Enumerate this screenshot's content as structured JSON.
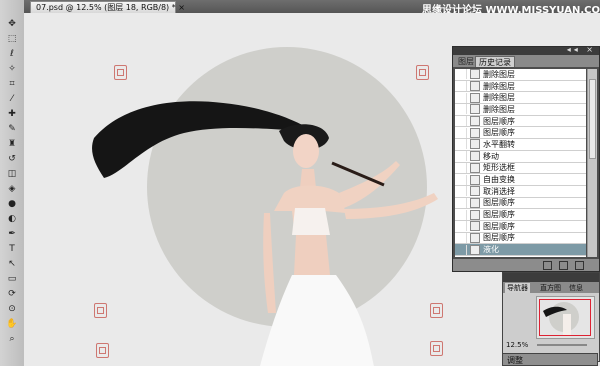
{
  "document_tab": {
    "title": "07.psd @ 12.5% (图层 18, RGB/8) *",
    "close": "×"
  },
  "watermark": "思缘设计论坛 WWW.MISSYUAN.COM",
  "toolbox": {
    "icons": [
      "move-tool-icon",
      "marquee-tool-icon",
      "lasso-tool-icon",
      "magic-wand-tool-icon",
      "crop-tool-icon",
      "eyedropper-tool-icon",
      "healing-brush-tool-icon",
      "brush-tool-icon",
      "clone-stamp-tool-icon",
      "history-brush-tool-icon",
      "eraser-tool-icon",
      "paint-bucket-tool-icon",
      "blur-tool-icon",
      "dodge-tool-icon",
      "pen-tool-icon",
      "type-tool-icon",
      "path-selection-tool-icon",
      "shape-tool-icon",
      "3d-rotate-tool-icon",
      "3d-orbit-tool-icon",
      "hand-tool-icon",
      "zoom-tool-icon"
    ],
    "glyphs": [
      "✥",
      "⬚",
      "ℓ",
      "✧",
      "⌗",
      "⁄",
      "✚",
      "✎",
      "♜",
      "↺",
      "◫",
      "◈",
      "●",
      "◐",
      "✒",
      "T",
      "↖",
      "▭",
      "⟳",
      "⊙",
      "✋",
      "⌕"
    ]
  },
  "panel": {
    "controls": "◂◂ ×",
    "tabs": [
      "图层",
      "历史记录"
    ],
    "active_tab": 1,
    "history": [
      "删除图层",
      "删除图层",
      "删除图层",
      "删除图层",
      "图层顺序",
      "图层顺序",
      "水平翻转",
      "移动",
      "矩形选框",
      "自由变换",
      "取消选择",
      "图层顺序",
      "图层顺序",
      "图层顺序",
      "图层顺序",
      "液化"
    ],
    "active_index": 15
  },
  "navigator": {
    "tabs": [
      "导航器",
      "直方图",
      "信息"
    ],
    "zoom": "12.5%"
  },
  "adjust_label": "调整",
  "colors": {
    "selection": "#7d9aa6",
    "stamp": "#c85b54",
    "frame": "#dd2233"
  }
}
